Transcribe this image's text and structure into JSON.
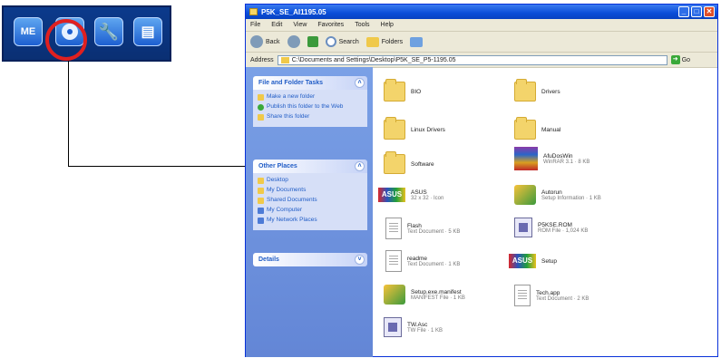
{
  "taskbar": {
    "icons": [
      {
        "name": "me-icon",
        "label": "ME"
      },
      {
        "name": "disc-icon",
        "label": ""
      },
      {
        "name": "wrench-icon",
        "label": "🔧"
      },
      {
        "name": "document-icon",
        "label": "▤"
      }
    ],
    "highlight_color": "#e02020"
  },
  "window": {
    "title": "P5K_SE_AI1195.05",
    "menu": [
      "File",
      "Edit",
      "View",
      "Favorites",
      "Tools",
      "Help"
    ],
    "toolbar": {
      "back": "Back",
      "search": "Search",
      "folders": "Folders"
    },
    "address_label": "Address",
    "address_value": "C:\\Documents and Settings\\Desktop\\P5K_SE_P5-1195.05",
    "go_label": "Go"
  },
  "left_pane": {
    "tasks_header": "File and Folder Tasks",
    "tasks": [
      "Make a new folder",
      "Publish this folder to the Web",
      "Share this folder"
    ],
    "other_header": "Other Places",
    "places": [
      "Desktop",
      "My Documents",
      "Shared Documents",
      "My Computer",
      "My Network Places"
    ],
    "details_header": "Details"
  },
  "files": [
    {
      "name": "BIO",
      "meta": ""
    },
    {
      "name": "Drivers",
      "meta": ""
    },
    {
      "name": "Linux Drivers",
      "meta": ""
    },
    {
      "name": "Manual",
      "meta": ""
    },
    {
      "name": "Software",
      "meta": ""
    },
    {
      "name": "AfuDosWin",
      "meta": "WinRAR 3.1 · 8 KB"
    },
    {
      "name": "ASUS",
      "meta": "32 x 32 · Icon"
    },
    {
      "name": "Autorun",
      "meta": "Setup Information · 1 KB"
    },
    {
      "name": "Flash",
      "meta": "Text Document · 5 KB"
    },
    {
      "name": "P5KSE.ROM",
      "meta": "ROM File · 1,024 KB"
    },
    {
      "name": "readme",
      "meta": "Text Document · 1 KB"
    },
    {
      "name": "Setup",
      "meta": ""
    },
    {
      "name": "Setup.exe.manifest",
      "meta": "MANIFEST File · 1 KB"
    },
    {
      "name": "Tech.app",
      "meta": "Text Document · 2 KB"
    },
    {
      "name": "TW.Asc",
      "meta": "TW File · 1 KB"
    }
  ]
}
